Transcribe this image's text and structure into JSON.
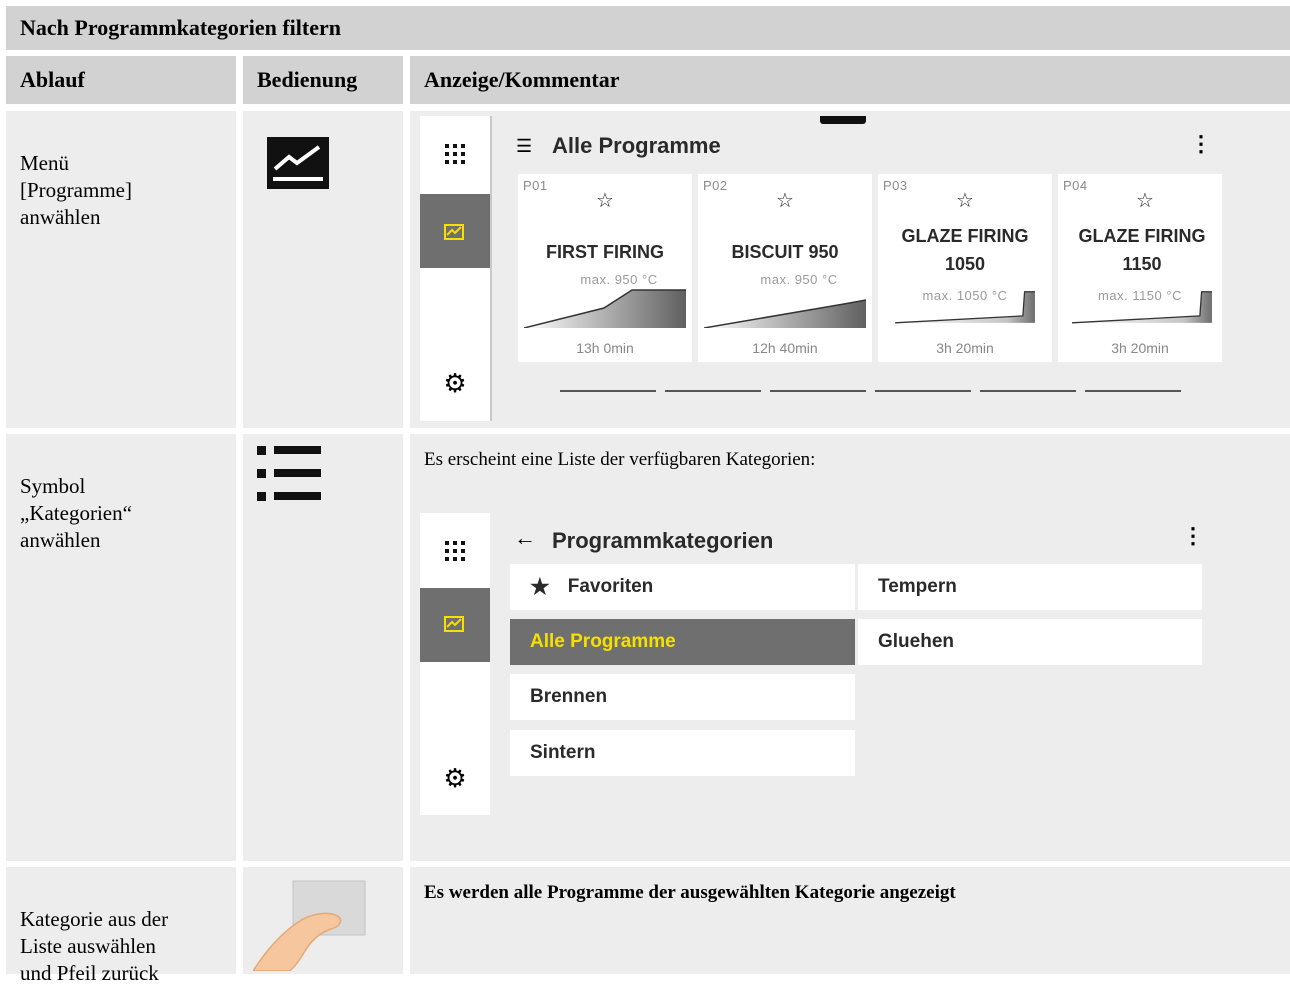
{
  "title": "Nach Programmkategorien filtern",
  "columns": {
    "ablauf": "Ablauf",
    "bedienung": "Bedienung",
    "anzeige": "Anzeige/Kommentar"
  },
  "rows": [
    {
      "ablauf": "Menü\n[Programme]\nanwählen",
      "icon": "chart-icon"
    },
    {
      "ablauf": "Symbol\n„Kategorien“\nanwählen",
      "icon": "list-icon",
      "comment": "Es erscheint eine Liste der verfügbaren Kategorien:"
    },
    {
      "ablauf": "Kategorie aus der\nListe auswählen\nund Pfeil zurück",
      "icon": "touch-icon",
      "comment": "Es werden alle Programme der ausgewählten Kategorie angezeigt"
    }
  ],
  "screen1": {
    "title": "Alle Programme",
    "programs": [
      {
        "code": "P01",
        "name": "FIRST FIRING",
        "max": "max. 950 °C",
        "duration": "13h 0min"
      },
      {
        "code": "P02",
        "name": "BISCUIT 950",
        "max": "max. 950 °C",
        "duration": "12h 40min"
      },
      {
        "code": "P03",
        "name": "GLAZE FIRING\n1050",
        "max": "max. 1050 °C",
        "duration": "3h 20min"
      },
      {
        "code": "P04",
        "name": "GLAZE FIRING\n1150",
        "max": "max. 1150 °C",
        "duration": "3h 20min"
      }
    ]
  },
  "screen2": {
    "title": "Programmkategorien",
    "categories_left": [
      "Favoriten",
      "Alle Programme",
      "Brennen",
      "Sintern"
    ],
    "categories_right": [
      "Tempern",
      "Gluehen"
    ],
    "selected": "Alle Programme",
    "highlight_color": "#f5e000"
  }
}
